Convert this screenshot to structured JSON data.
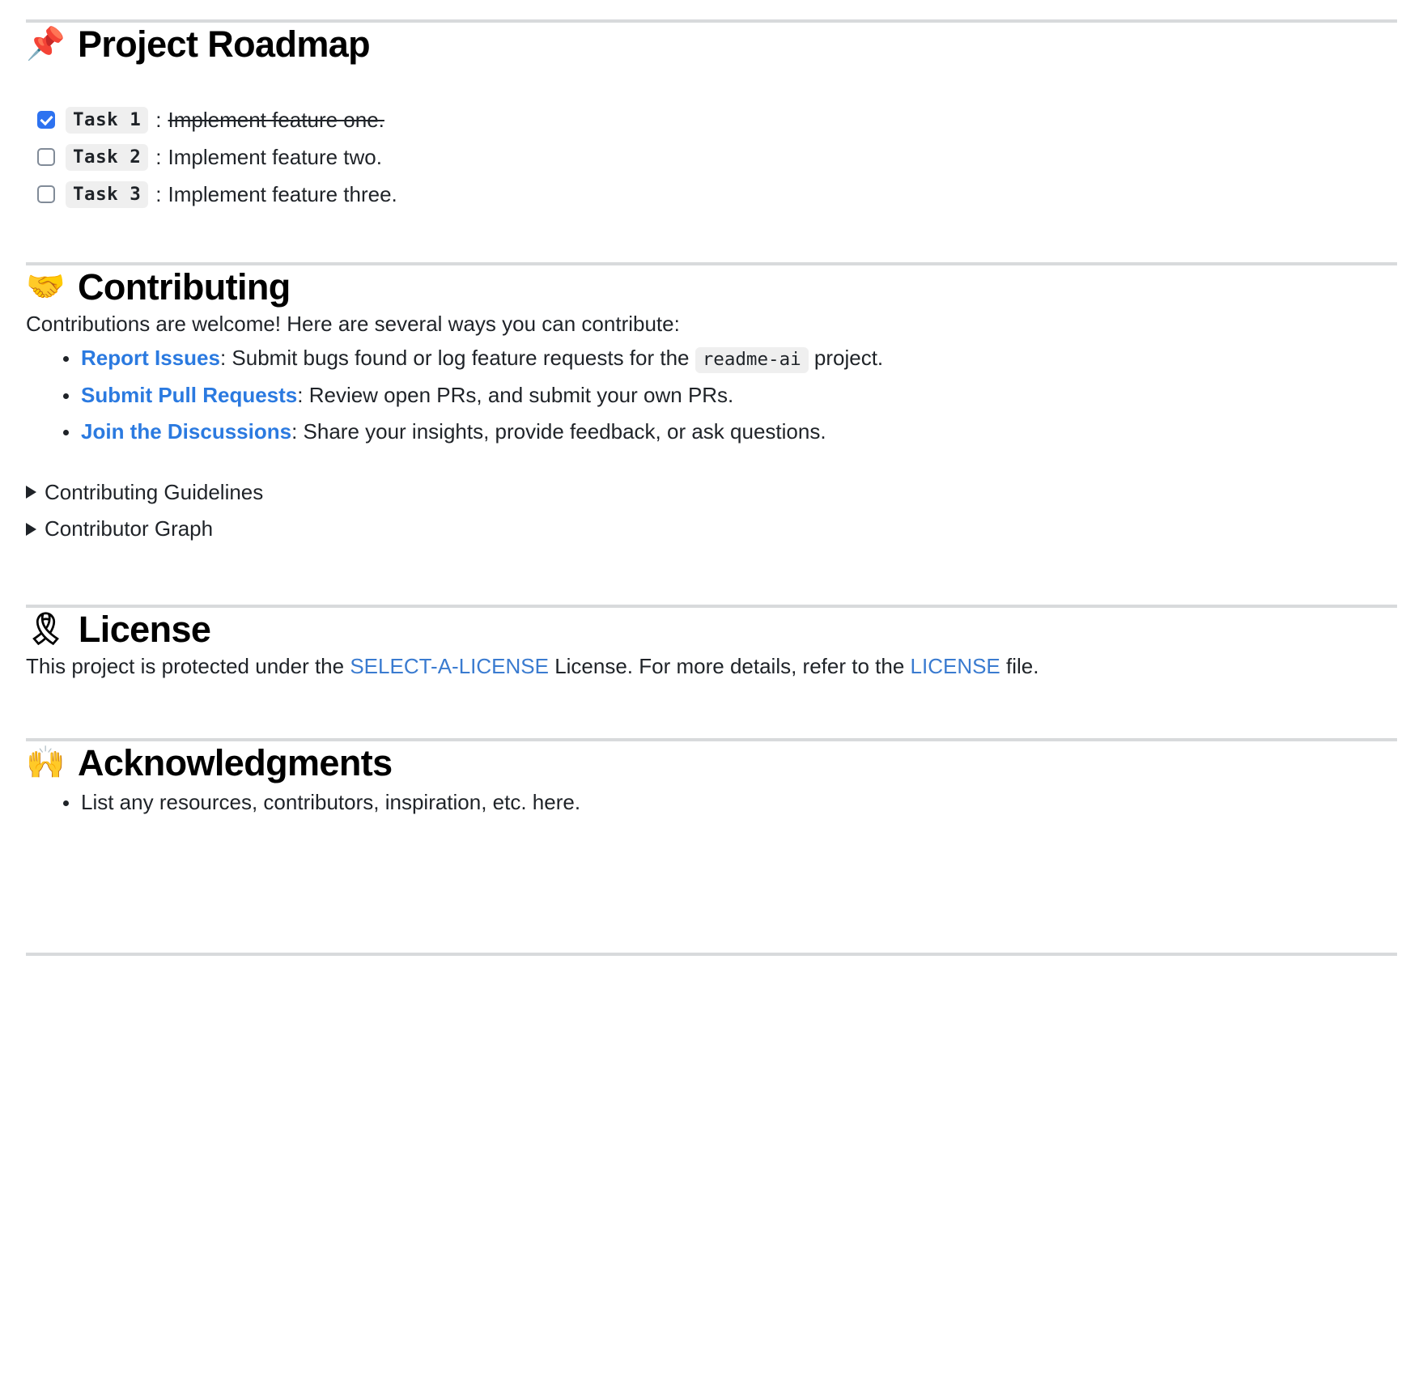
{
  "document": {
    "sections": [
      {
        "id": "roadmap",
        "emoji": "📌",
        "emoji_name": "pushpin-emoji",
        "title": "Project Roadmap"
      },
      {
        "id": "contributing",
        "emoji": "🤝",
        "emoji_name": "handshake-emoji",
        "title": "Contributing"
      },
      {
        "id": "license",
        "emoji": "🎗",
        "emoji_name": "reminder-ribbon-emoji",
        "title": "License"
      },
      {
        "id": "acknowledgments",
        "emoji": "🙌",
        "emoji_name": "raising-hands-emoji",
        "title": "Acknowledgments"
      }
    ]
  },
  "roadmap": {
    "title": "Project Roadmap",
    "emoji": "📌",
    "tasks": [
      {
        "label": "Task 1",
        "separator": ":",
        "text": "Implement feature one.",
        "checked": true
      },
      {
        "label": "Task 2",
        "separator": ":",
        "text": "Implement feature two.",
        "checked": false
      },
      {
        "label": "Task 3",
        "separator": ":",
        "text": "Implement feature three.",
        "checked": false
      }
    ]
  },
  "contributing": {
    "title": "Contributing",
    "emoji": "🤝",
    "intro": "Contributions are welcome! Here are several ways you can contribute:",
    "items": [
      {
        "link": "Report Issues",
        "text_before_code": ": Submit bugs found or log feature requests for the ",
        "code": "readme-ai",
        "text_after_code": " project."
      },
      {
        "link": "Submit Pull Requests",
        "text_before_code": ": Review open PRs, and submit your own PRs.",
        "code": "",
        "text_after_code": ""
      },
      {
        "link": "Join the Discussions",
        "text_before_code": ": Share your insights, provide feedback, or ask questions.",
        "code": "",
        "text_after_code": ""
      }
    ],
    "details": [
      {
        "summary": "Contributing Guidelines",
        "open": false
      },
      {
        "summary": "Contributor Graph",
        "open": false
      }
    ]
  },
  "license": {
    "title": "License",
    "emoji": "🎗",
    "text_start": "This project is protected under the ",
    "link_name": "SELECT-A-LICENSE",
    "text_middle": " License. For more details, refer to the ",
    "link_file": "LICENSE",
    "text_end": " file."
  },
  "acknowledgments": {
    "title": "Acknowledgments",
    "emoji": "🙌",
    "items": [
      "List any resources, contributors, inspiration, etc. here."
    ]
  },
  "theme": {
    "link_color": "#3a7bd0",
    "link_bold_color": "#2b7ae0",
    "checkbox_checked_color": "#2d72f0",
    "code_background": "#efefef",
    "rule_color": "#d8dadc",
    "text_color": "#1f2328"
  }
}
